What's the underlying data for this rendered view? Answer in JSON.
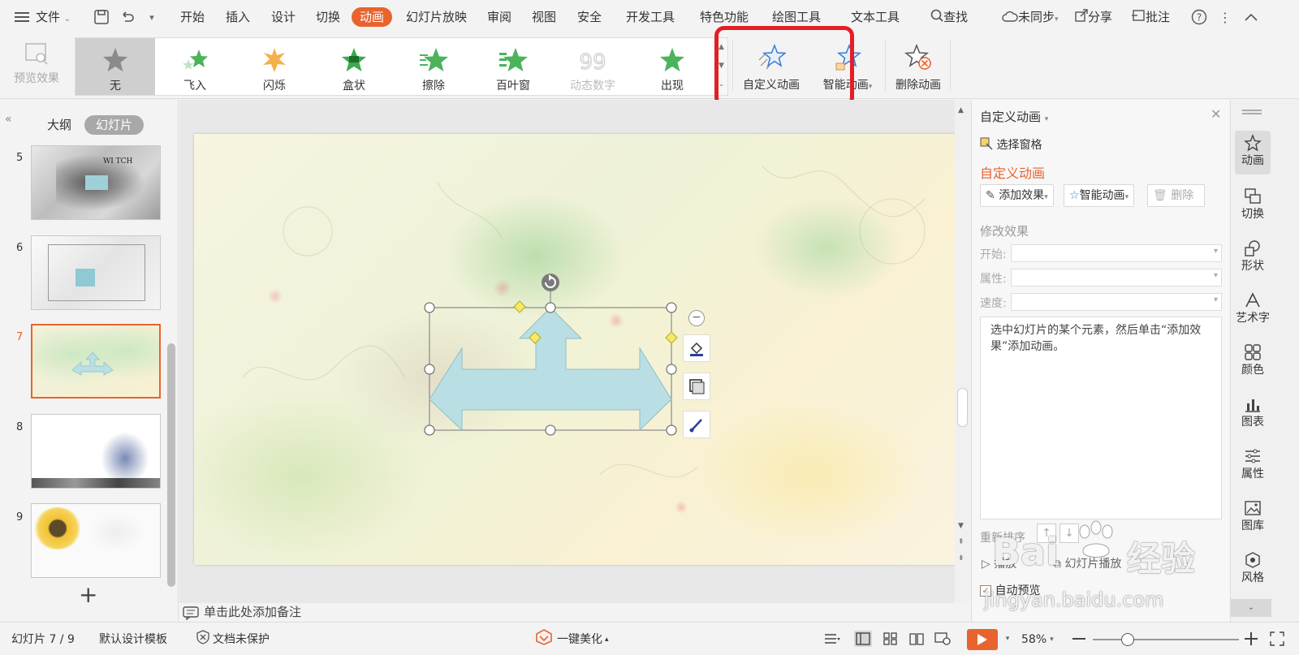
{
  "menubar": {
    "file_label": "文件",
    "tabs": [
      {
        "label": "开始"
      },
      {
        "label": "插入"
      },
      {
        "label": "设计"
      },
      {
        "label": "切换"
      },
      {
        "label": "动画",
        "active": true
      },
      {
        "label": "幻灯片放映"
      },
      {
        "label": "审阅"
      },
      {
        "label": "视图"
      },
      {
        "label": "安全"
      },
      {
        "label": "开发工具"
      },
      {
        "label": "特色功能"
      },
      {
        "label": "绘图工具"
      },
      {
        "label": "文本工具"
      }
    ],
    "search_label": "查找",
    "sync_label": "未同步",
    "share_label": "分享",
    "comment_label": "批注"
  },
  "ribbon": {
    "preview_label": "预览效果",
    "gallery": [
      {
        "label": "无",
        "selected": true,
        "icon": "star-gray"
      },
      {
        "label": "飞入",
        "icon": "star-fly"
      },
      {
        "label": "闪烁",
        "icon": "star-flash"
      },
      {
        "label": "盒状",
        "icon": "star-box"
      },
      {
        "label": "擦除",
        "icon": "star-wipe"
      },
      {
        "label": "百叶窗",
        "icon": "star-blinds"
      },
      {
        "label": "动态数字",
        "icon": "digits-99",
        "disabled": true
      },
      {
        "label": "出现",
        "icon": "star-appear"
      }
    ],
    "custom_animation_label": "自定义动画",
    "smart_animation_label": "智能动画",
    "delete_animation_label": "删除动画"
  },
  "slides_panel": {
    "tab_outline": "大纲",
    "tab_slides": "幻灯片",
    "slides": [
      {
        "number": "5"
      },
      {
        "number": "6"
      },
      {
        "number": "7",
        "current": true
      },
      {
        "number": "8"
      },
      {
        "number": "9"
      }
    ],
    "thumb5_text": "WI TCH"
  },
  "canvas": {
    "notes_placeholder": "单击此处添加备注"
  },
  "taskpane": {
    "title": "自定义动画",
    "selection_pane": "选择窗格",
    "section_title": "自定义动画",
    "add_effect": "添加效果",
    "smart_animation": "智能动画",
    "delete": "删除",
    "modify_effect": "修改效果",
    "start_label": "开始:",
    "property_label": "属性:",
    "speed_label": "速度:",
    "hint_text": "选中幻灯片的某个元素，然后单击“添加效果”添加动画。",
    "reorder_label": "重新排序",
    "play_label": "播放",
    "slideshow_label": "幻灯片播放",
    "auto_preview_label": "自动预览",
    "auto_preview_checked": true
  },
  "sidetools": [
    {
      "label": "动画",
      "icon": "animation-star-icon",
      "active": true
    },
    {
      "label": "切换",
      "icon": "transition-icon"
    },
    {
      "label": "形状",
      "icon": "shape-icon"
    },
    {
      "label": "艺术字",
      "icon": "wordart-icon"
    },
    {
      "label": "颜色",
      "icon": "color-icon"
    },
    {
      "label": "图表",
      "icon": "chart-icon"
    },
    {
      "label": "属性",
      "icon": "properties-icon"
    },
    {
      "label": "图库",
      "icon": "gallery-icon"
    },
    {
      "label": "风格",
      "icon": "style-icon"
    }
  ],
  "statusbar": {
    "slide_indicator": "幻灯片 7 / 9",
    "template": "默认设计模板",
    "protection": "文档未保护",
    "beautify": "一键美化",
    "zoom": "58%"
  },
  "watermark": {
    "brand": "Bai",
    "du_word": "经验",
    "url": "jingyan.baidu.com"
  },
  "colors": {
    "accent": "#e8632e",
    "highlight": "#e41e26",
    "arrow_fill": "#b9dfe4"
  }
}
